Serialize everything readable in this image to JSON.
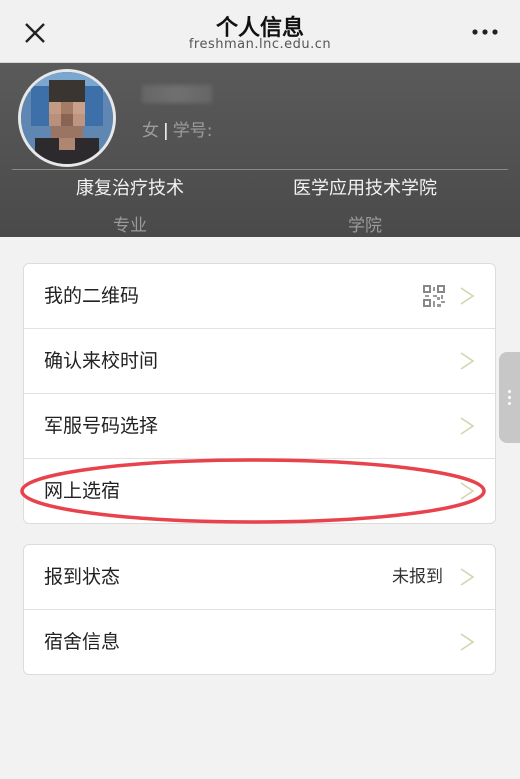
{
  "header": {
    "title": "个人信息",
    "url": "freshman.lnc.edu.cn",
    "close_icon": "close-icon",
    "more_icon": "more-horizontal-icon"
  },
  "profile": {
    "gender": "女",
    "separator": "|",
    "student_id_label": "学号:",
    "major_value": "康复治疗技术",
    "major_label": "专业",
    "college_value": "医学应用技术学院",
    "college_label": "学院"
  },
  "menu_group_1": [
    {
      "label": "我的二维码",
      "icon": "qr-code-icon"
    },
    {
      "label": "确认来校时间"
    },
    {
      "label": "军服号码选择"
    },
    {
      "label": "网上选宿"
    }
  ],
  "menu_group_2": [
    {
      "label": "报到状态",
      "value": "未报到"
    },
    {
      "label": "宿舍信息"
    }
  ],
  "colors": {
    "annotation": "#e8424c",
    "chevron": "#d4d4b0",
    "profile_bg": "#555555"
  }
}
